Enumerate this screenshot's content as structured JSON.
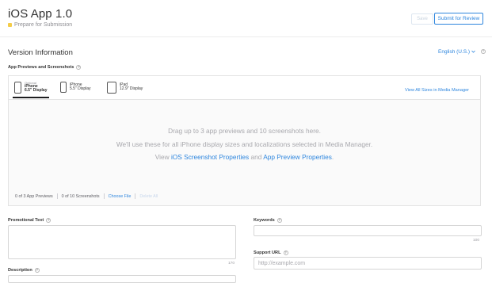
{
  "header": {
    "app_title": "iOS App 1.0",
    "status_text": "Prepare for Submission",
    "status_color": "#f4cc48",
    "save_label": "Save",
    "submit_label": "Submit for Review"
  },
  "version_info": {
    "title": "Version Information",
    "language": "English (U.S.)",
    "language_chevron": "chevron-down-icon",
    "help_glyph": "?"
  },
  "media": {
    "label": "App Previews and Screenshots",
    "tabs": [
      {
        "optional": "Optional",
        "line1": "iPhone",
        "line2": "6.5\" Display",
        "active": true
      },
      {
        "optional": "",
        "line1": "iPhone",
        "line2": "5.5\" Display",
        "active": false
      },
      {
        "optional": "",
        "line1": "iPad",
        "line2": "12.9\" Display",
        "active": false
      }
    ],
    "view_all_sizes": "View All Sizes in Media Manager",
    "drag_line1": "Drag up to 3 app previews and 10 screenshots here.",
    "drag_line2": "We'll use these for all iPhone display sizes and localizations selected in Media Manager.",
    "drag_line3_prefix": "View",
    "drag_link1": "iOS Screenshot Properties",
    "drag_line3_and": "and",
    "drag_link2": "App Preview Properties",
    "drag_line3_suffix": ".",
    "app_previews_count": "0 of 3 App Previews",
    "screenshots_count": "0 of 10 Screenshots",
    "choose_file": "Choose File",
    "delete_all": "Delete All"
  },
  "form": {
    "promotional_text_label": "Promotional Text",
    "promotional_counter": "170",
    "keywords_label": "Keywords",
    "keywords_counter": "100",
    "support_url_label": "Support URL",
    "support_url_placeholder": "http://example.com",
    "description_label": "Description"
  },
  "colors": {
    "accent": "#2e86de",
    "status_yellow": "#f4cc48"
  }
}
